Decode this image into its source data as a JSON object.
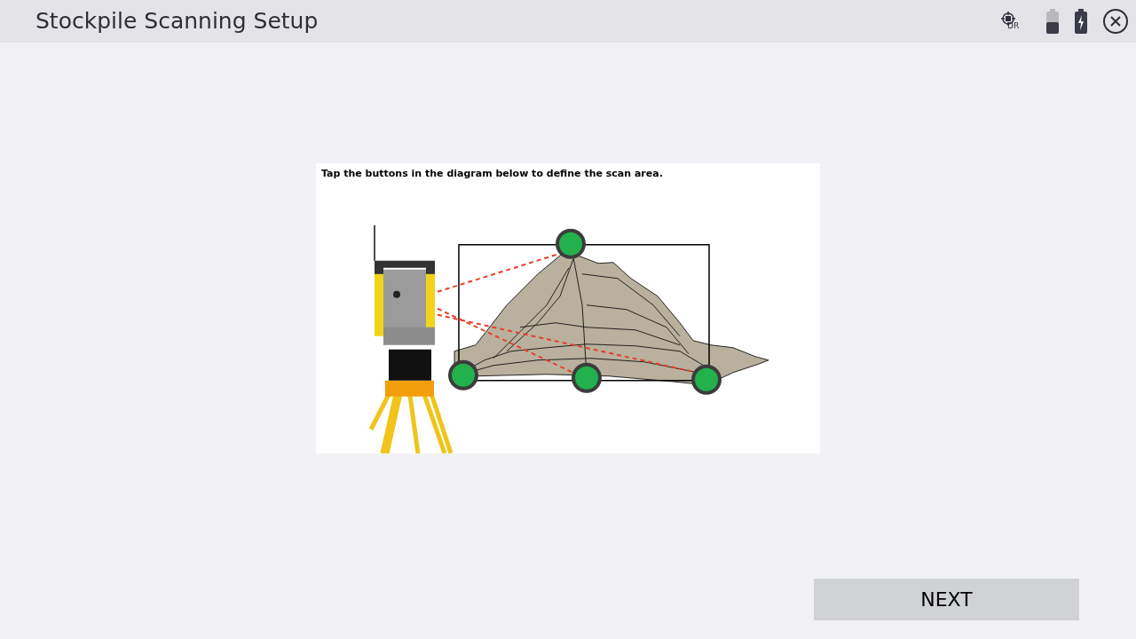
{
  "window": {
    "title": "Stockpile Scanning Setup"
  },
  "status": {
    "target_label": "DR"
  },
  "diagram": {
    "instruction": "Tap the buttons in the diagram below to define the scan area."
  },
  "buttons": [
    {
      "label": "NEXT"
    }
  ]
}
